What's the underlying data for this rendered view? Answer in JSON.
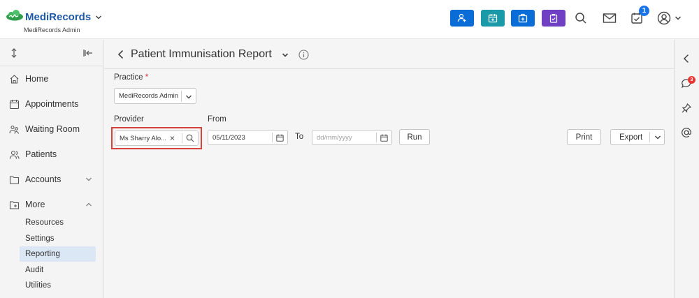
{
  "app": {
    "brand": "MediRecords",
    "subtitle": "MediRecords Admin"
  },
  "header": {
    "quick_actions": [
      {
        "name": "add-patient",
        "icon": "person-plus-icon",
        "color": "#0a6cd6"
      },
      {
        "name": "add-appointment",
        "icon": "calendar-plus-icon",
        "color": "#1a9aa8"
      },
      {
        "name": "medical-kit",
        "icon": "medical-bag-icon",
        "color": "#0a6cd6"
      },
      {
        "name": "clipboard-task",
        "icon": "clipboard-icon",
        "color": "#6f3fc4"
      }
    ],
    "tasks_badge": "1"
  },
  "sidebar": {
    "items": [
      {
        "label": "Home",
        "icon": "home-icon"
      },
      {
        "label": "Appointments",
        "icon": "calendar-icon"
      },
      {
        "label": "Waiting Room",
        "icon": "people-icon"
      },
      {
        "label": "Patients",
        "icon": "users-icon"
      },
      {
        "label": "Accounts",
        "icon": "folder-icon"
      },
      {
        "label": "More",
        "icon": "folder-more-icon"
      }
    ],
    "more_items": [
      {
        "label": "Resources"
      },
      {
        "label": "Settings"
      },
      {
        "label": "Reporting",
        "active": true
      },
      {
        "label": "Audit"
      },
      {
        "label": "Utilities"
      }
    ]
  },
  "page": {
    "title": "Patient Immunisation Report",
    "practice_label": "Practice",
    "required_mark": "*",
    "practice_value": "MediRecords Admin",
    "provider_label": "Provider",
    "provider_value": "Ms Sharry Alo...",
    "clear_glyph": "×",
    "from_label": "From",
    "from_value": "05/11/2023",
    "to_label": "To",
    "to_placeholder": "dd/mm/yyyy",
    "run_label": "Run",
    "print_label": "Print",
    "export_label": "Export"
  },
  "right_rail": {
    "notification_badge": "3"
  },
  "colors": {
    "highlight": "#d9423b",
    "active_nav": "#dbe7f5",
    "brand_blue": "#1f5aa6"
  }
}
